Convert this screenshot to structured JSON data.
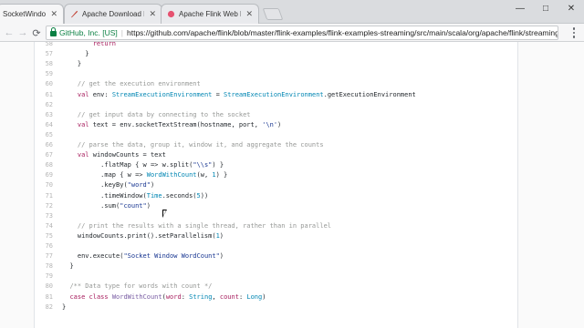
{
  "tabs": [
    {
      "title": "SocketWindowWo",
      "active": true
    },
    {
      "title": "Apache Download Mirro",
      "active": false
    },
    {
      "title": "Apache Flink Web Dashb",
      "active": false
    }
  ],
  "toolbar": {
    "back": "←",
    "forward": "→",
    "reload": "⟳",
    "secure_label": "GitHub, Inc. [US]",
    "url": "https://github.com/apache/flink/blob/master/flink-examples/flink-examples-streaming/src/main/scala/org/apache/flink/streaming/scala/example:"
  },
  "window_controls": {
    "minimize": "—",
    "maximize": "□",
    "close": "✕"
  },
  "code_lines": [
    {
      "num": "58",
      "indent": "        ",
      "parts": [
        {
          "t": "return",
          "c": "kw"
        }
      ]
    },
    {
      "num": "57",
      "indent": "      ",
      "parts": [
        {
          "t": "}",
          "c": ""
        }
      ]
    },
    {
      "num": "58",
      "indent": "    ",
      "parts": [
        {
          "t": "}",
          "c": ""
        }
      ]
    },
    {
      "num": "59",
      "indent": "",
      "parts": []
    },
    {
      "num": "60",
      "indent": "    ",
      "parts": [
        {
          "t": "// get the execution environment",
          "c": "comment"
        }
      ]
    },
    {
      "num": "61",
      "indent": "    ",
      "parts": [
        {
          "t": "val",
          "c": "kw"
        },
        {
          "t": " env: ",
          "c": ""
        },
        {
          "t": "StreamExecutionEnvironment",
          "c": "type"
        },
        {
          "t": " = ",
          "c": ""
        },
        {
          "t": "StreamExecutionEnvironment",
          "c": "type"
        },
        {
          "t": ".getExecutionEnvironment",
          "c": ""
        }
      ]
    },
    {
      "num": "62",
      "indent": "",
      "parts": []
    },
    {
      "num": "63",
      "indent": "    ",
      "parts": [
        {
          "t": "// get input data by connecting to the socket",
          "c": "comment"
        }
      ]
    },
    {
      "num": "64",
      "indent": "    ",
      "parts": [
        {
          "t": "val",
          "c": "kw"
        },
        {
          "t": " text = env.socketTextStream(hostname, port, ",
          "c": ""
        },
        {
          "t": "'\\n'",
          "c": "str"
        },
        {
          "t": ")",
          "c": ""
        }
      ]
    },
    {
      "num": "65",
      "indent": "",
      "parts": []
    },
    {
      "num": "66",
      "indent": "    ",
      "parts": [
        {
          "t": "// parse the data, group it, window it, and aggregate the counts",
          "c": "comment"
        }
      ]
    },
    {
      "num": "67",
      "indent": "    ",
      "parts": [
        {
          "t": "val",
          "c": "kw"
        },
        {
          "t": " windowCounts = text",
          "c": ""
        }
      ]
    },
    {
      "num": "68",
      "indent": "          ",
      "parts": [
        {
          "t": ".flatMap { w => w.split(",
          "c": ""
        },
        {
          "t": "\"\\\\s\"",
          "c": "str"
        },
        {
          "t": ") }",
          "c": ""
        }
      ]
    },
    {
      "num": "69",
      "indent": "          ",
      "parts": [
        {
          "t": ".map { w => ",
          "c": ""
        },
        {
          "t": "WordWithCount",
          "c": "type"
        },
        {
          "t": "(w, ",
          "c": ""
        },
        {
          "t": "1",
          "c": "type"
        },
        {
          "t": ") }",
          "c": ""
        }
      ]
    },
    {
      "num": "70",
      "indent": "          ",
      "parts": [
        {
          "t": ".keyBy(",
          "c": ""
        },
        {
          "t": "\"word\"",
          "c": "str"
        },
        {
          "t": ")",
          "c": ""
        }
      ]
    },
    {
      "num": "71",
      "indent": "          ",
      "parts": [
        {
          "t": ".timeWindow(",
          "c": ""
        },
        {
          "t": "Time",
          "c": "type"
        },
        {
          "t": ".seconds(",
          "c": ""
        },
        {
          "t": "5",
          "c": "type"
        },
        {
          "t": "))",
          "c": ""
        }
      ]
    },
    {
      "num": "72",
      "indent": "          ",
      "parts": [
        {
          "t": ".sum(",
          "c": ""
        },
        {
          "t": "\"count\"",
          "c": "str"
        },
        {
          "t": ")",
          "c": ""
        }
      ]
    },
    {
      "num": "73",
      "indent": "",
      "parts": []
    },
    {
      "num": "74",
      "indent": "    ",
      "parts": [
        {
          "t": "// print the results with a single thread, rather than in parallel",
          "c": "comment"
        }
      ]
    },
    {
      "num": "75",
      "indent": "    ",
      "parts": [
        {
          "t": "windowCounts.print().setParallelism(",
          "c": ""
        },
        {
          "t": "1",
          "c": "type"
        },
        {
          "t": ")",
          "c": ""
        }
      ]
    },
    {
      "num": "76",
      "indent": "",
      "parts": []
    },
    {
      "num": "77",
      "indent": "    ",
      "parts": [
        {
          "t": "env.execute(",
          "c": ""
        },
        {
          "t": "\"Socket Window WordCount\"",
          "c": "str"
        },
        {
          "t": ")",
          "c": ""
        }
      ]
    },
    {
      "num": "78",
      "indent": "  ",
      "parts": [
        {
          "t": "}",
          "c": ""
        }
      ]
    },
    {
      "num": "79",
      "indent": "",
      "parts": []
    },
    {
      "num": "80",
      "indent": "  ",
      "parts": [
        {
          "t": "/** Data type for words with count */",
          "c": "comment"
        }
      ]
    },
    {
      "num": "81",
      "indent": "  ",
      "parts": [
        {
          "t": "case class",
          "c": "kw"
        },
        {
          "t": " ",
          "c": ""
        },
        {
          "t": "WordWithCount",
          "c": "fn"
        },
        {
          "t": "(",
          "c": ""
        },
        {
          "t": "word",
          "c": "kw"
        },
        {
          "t": ": ",
          "c": ""
        },
        {
          "t": "String",
          "c": "type"
        },
        {
          "t": ", ",
          "c": ""
        },
        {
          "t": "count",
          "c": "kw"
        },
        {
          "t": ": ",
          "c": ""
        },
        {
          "t": "Long",
          "c": "type"
        },
        {
          "t": ")",
          "c": ""
        }
      ]
    },
    {
      "num": "82",
      "indent": "",
      "parts": [
        {
          "t": "}",
          "c": ""
        }
      ]
    }
  ]
}
